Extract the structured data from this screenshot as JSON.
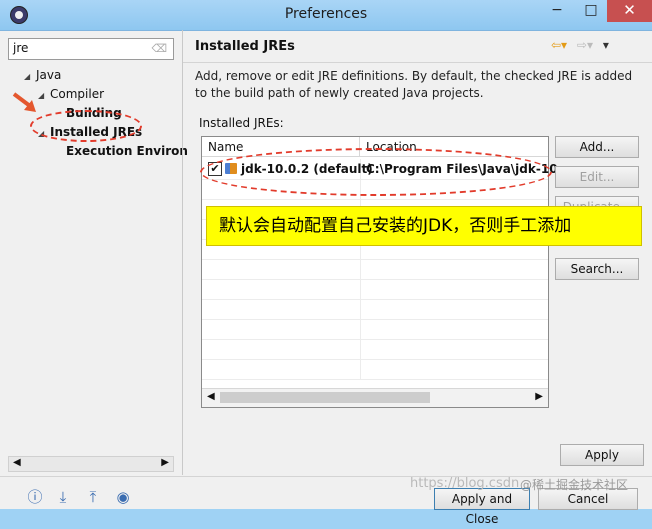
{
  "window": {
    "title": "Preferences",
    "minimize": "−",
    "maximize": "□",
    "close": "✕"
  },
  "filter": {
    "value": "jre"
  },
  "tree": [
    {
      "label": "Java",
      "arrow": "◢",
      "bold": false
    },
    {
      "label": "Compiler",
      "arrow": "◢",
      "bold": false
    },
    {
      "label": "Building",
      "arrow": "",
      "bold": true
    },
    {
      "label": "Installed JREs",
      "arrow": "◢",
      "bold": true
    },
    {
      "label": "Execution Environ",
      "arrow": "",
      "bold": true
    }
  ],
  "page": {
    "title": "Installed JREs",
    "description": "Add, remove or edit JRE definitions. By default, the checked JRE is added to the build path of newly created Java projects.",
    "table_label": "Installed JREs:",
    "columns": {
      "name": "Name",
      "location": "Location"
    },
    "rows": [
      {
        "checked": true,
        "name": "jdk-10.0.2 (default)",
        "location": "C:\\Program Files\\Java\\jdk-10..."
      }
    ]
  },
  "buttons": {
    "add": "Add...",
    "edit": "Edit...",
    "duplicate": "Duplicate...",
    "search": "Search...",
    "apply": "Apply",
    "apply_close": "Apply and Close",
    "cancel": "Cancel"
  },
  "callout": "默认会自动配置自己安装的JDK，否则手工添加",
  "watermark": {
    "url": "https://blog.csdn",
    "site": "@稀土掘金技术社区"
  },
  "bottom_icons": [
    "help-icon",
    "import-icon",
    "export-icon",
    "record-icon"
  ]
}
